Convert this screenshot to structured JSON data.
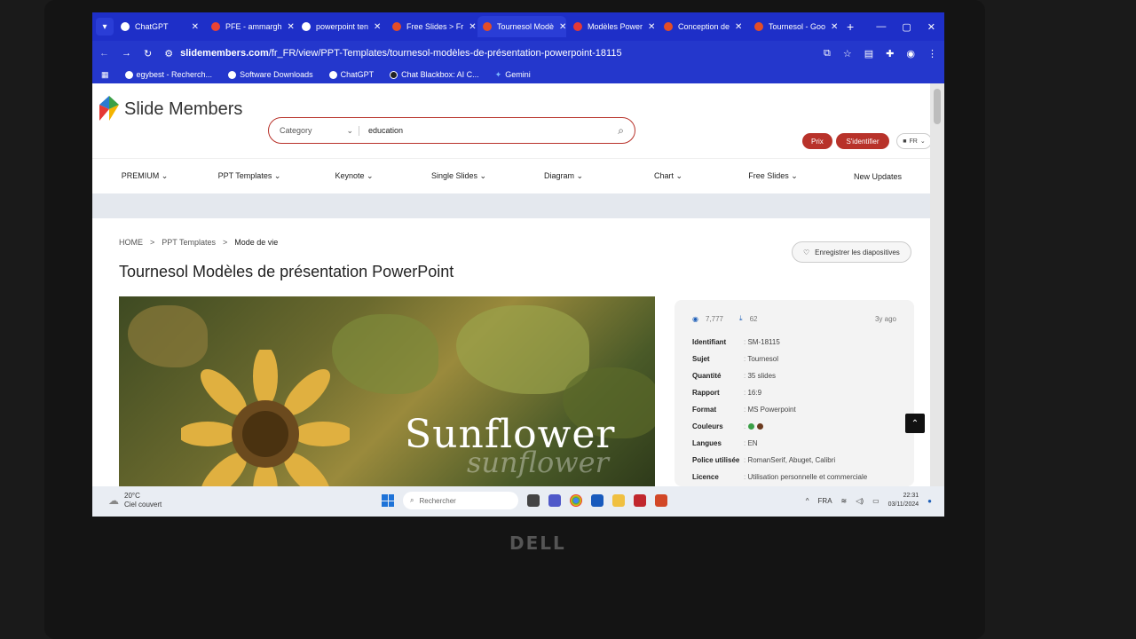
{
  "browser": {
    "tabs": [
      {
        "label": "ChatGPT",
        "color": "#ffffff"
      },
      {
        "label": "PFE - ammargh",
        "color": "#ea4335"
      },
      {
        "label": "powerpoint ten",
        "color": "#ffffff"
      },
      {
        "label": "Free Slides > Fr",
        "color": "#e44d26"
      },
      {
        "label": "Tournesol Modè",
        "color": "#e44d26",
        "active": true
      },
      {
        "label": "Modèles Power",
        "color": "#e53935"
      },
      {
        "label": "Conception de",
        "color": "#e44d26"
      },
      {
        "label": "Tournesol - Goo",
        "color": "#e44d26"
      }
    ],
    "url_host": "slidemembers.com",
    "url_path": "/fr_FR/view/PPT-Templates/tournesol-modèles-de-présentation-powerpoint-18115",
    "bookmarks": [
      "egybest - Recherch...",
      "Software Downloads",
      "ChatGPT",
      "Chat Blackbox: AI C...",
      "Gemini"
    ]
  },
  "site": {
    "logo_a": "Slide",
    "logo_b": "Members",
    "search_category": "Category",
    "search_query": "education",
    "prix": "Prix",
    "login": "S'identifier",
    "lang": "FR",
    "nav": [
      "PREMIUM",
      "PPT Templates",
      "Keynote",
      "Single Slides",
      "Diagram",
      "Chart",
      "Free Slides",
      "New Updates"
    ]
  },
  "product": {
    "crumbs": [
      "HOME",
      ">",
      "PPT Templates",
      ">",
      "Mode de vie"
    ],
    "title": "Tournesol Modèles de présentation PowerPoint",
    "save_label": "Enregistrer les diapositives",
    "hero_word": "Sunflower",
    "hero_word_script": "sunflower",
    "views": "7,777",
    "downloads": "62",
    "ago": "3y ago",
    "details": [
      {
        "k": "Identifiant",
        "v": "SM-18115"
      },
      {
        "k": "Sujet",
        "v": "Tournesol"
      },
      {
        "k": "Quantité",
        "v": "35 slides"
      },
      {
        "k": "Rapport",
        "v": "16:9"
      },
      {
        "k": "Format",
        "v": "MS Powerpoint"
      },
      {
        "k": "Couleurs",
        "v": ""
      },
      {
        "k": "Langues",
        "v": "EN"
      },
      {
        "k": "Police utilisée",
        "v": "RomanSerif, Abuget, Calibri"
      },
      {
        "k": "Licence",
        "v": "Utilisation personnelle et commerciale"
      }
    ],
    "colors": [
      "#3aa047",
      "#6b3a1e"
    ]
  },
  "taskbar": {
    "temp": "20°C",
    "weather": "Ciel couvert",
    "search": "Rechercher",
    "lang": "FRA",
    "time": "22:31",
    "date": "03/11/2024"
  },
  "device": {
    "brand": "DELL"
  }
}
